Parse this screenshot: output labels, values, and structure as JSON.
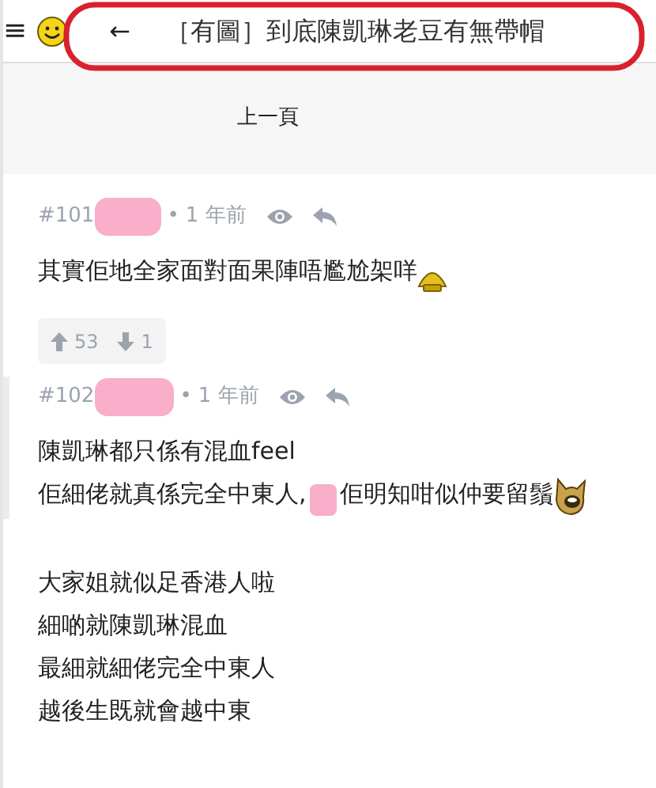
{
  "header": {
    "menu": "≡",
    "back": "←",
    "title": "［有圖］到底陳凱琳老豆有無帶帽"
  },
  "pager": {
    "label": "上一頁"
  },
  "posts": [
    {
      "number": "#101",
      "separator": "•",
      "time": "1 年前",
      "paragraphs": [
        [
          [
            {
              "kind": "text",
              "text": "其實佢地全家面對面果陣唔尷尬架咩"
            },
            {
              "kind": "helmet"
            }
          ]
        ]
      ],
      "votes": {
        "up": "53",
        "down": "1"
      },
      "marked": false
    },
    {
      "number": "#102",
      "separator": "•",
      "time": "1 年前",
      "paragraphs": [
        [
          [
            {
              "kind": "text",
              "text": "陳凱琳都只係有混血feel"
            }
          ],
          [
            {
              "kind": "text",
              "text": "佢細佬就真係完全中東人, "
            },
            {
              "kind": "redacted"
            },
            {
              "kind": "text",
              "text": "佢明知咁似仲要留鬚"
            },
            {
              "kind": "dog"
            }
          ]
        ],
        [
          [
            {
              "kind": "text",
              "text": "大家姐就似足香港人啦"
            }
          ],
          [
            {
              "kind": "text",
              "text": "細啲就陳凱琳混血"
            }
          ],
          [
            {
              "kind": "text",
              "text": "最細就細佬完全中東人"
            }
          ],
          [
            {
              "kind": "text",
              "text": "越後生既就會越中東"
            }
          ]
        ]
      ],
      "marked": true
    }
  ]
}
